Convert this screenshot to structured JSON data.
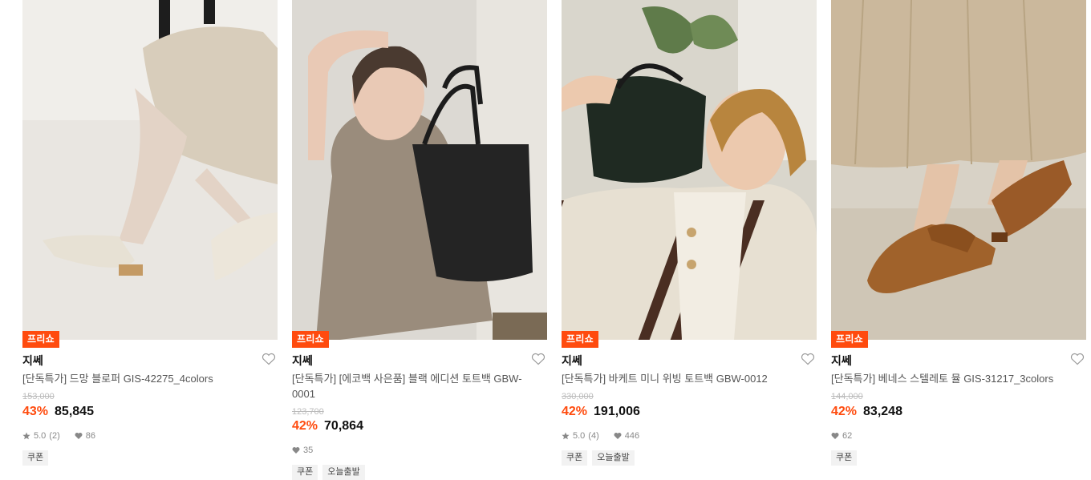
{
  "colors": {
    "accent": "#ff4b0e",
    "text": "#111111",
    "muted": "#888888"
  },
  "products": [
    {
      "badge": "프리쇼",
      "brand": "지쎄",
      "title": "[단독특가] 드망 블로퍼 GIS-42275_4colors",
      "original_price": "153,000",
      "discount": "43%",
      "price": "85,845",
      "rating": "5.0",
      "review_count": "(2)",
      "likes": "86",
      "tags": [
        "쿠폰"
      ],
      "image_icon": "product-image"
    },
    {
      "badge": "프리쇼",
      "brand": "지쎄",
      "title": "[단독특가] [에코백 사은품] 블랙 에디션 토트백 GBW-0001",
      "original_price": "123,700",
      "discount": "42%",
      "price": "70,864",
      "likes": "35",
      "tags": [
        "쿠폰",
        "오늘출발"
      ],
      "image_icon": "product-image"
    },
    {
      "badge": "프리쇼",
      "brand": "지쎄",
      "title": "[단독특가] 바케트 미니 위빙 토트백 GBW-0012",
      "original_price": "330,000",
      "discount": "42%",
      "price": "191,006",
      "rating": "5.0",
      "review_count": "(4)",
      "likes": "446",
      "tags": [
        "쿠폰",
        "오늘출발"
      ],
      "image_icon": "product-image"
    },
    {
      "badge": "프리쇼",
      "brand": "지쎄",
      "title": "[단독특가] 베네스 스텔레토 뮬 GIS-31217_3colors",
      "original_price": "144,000",
      "discount": "42%",
      "price": "83,248",
      "likes": "62",
      "tags": [
        "쿠폰"
      ],
      "image_icon": "product-image"
    }
  ]
}
